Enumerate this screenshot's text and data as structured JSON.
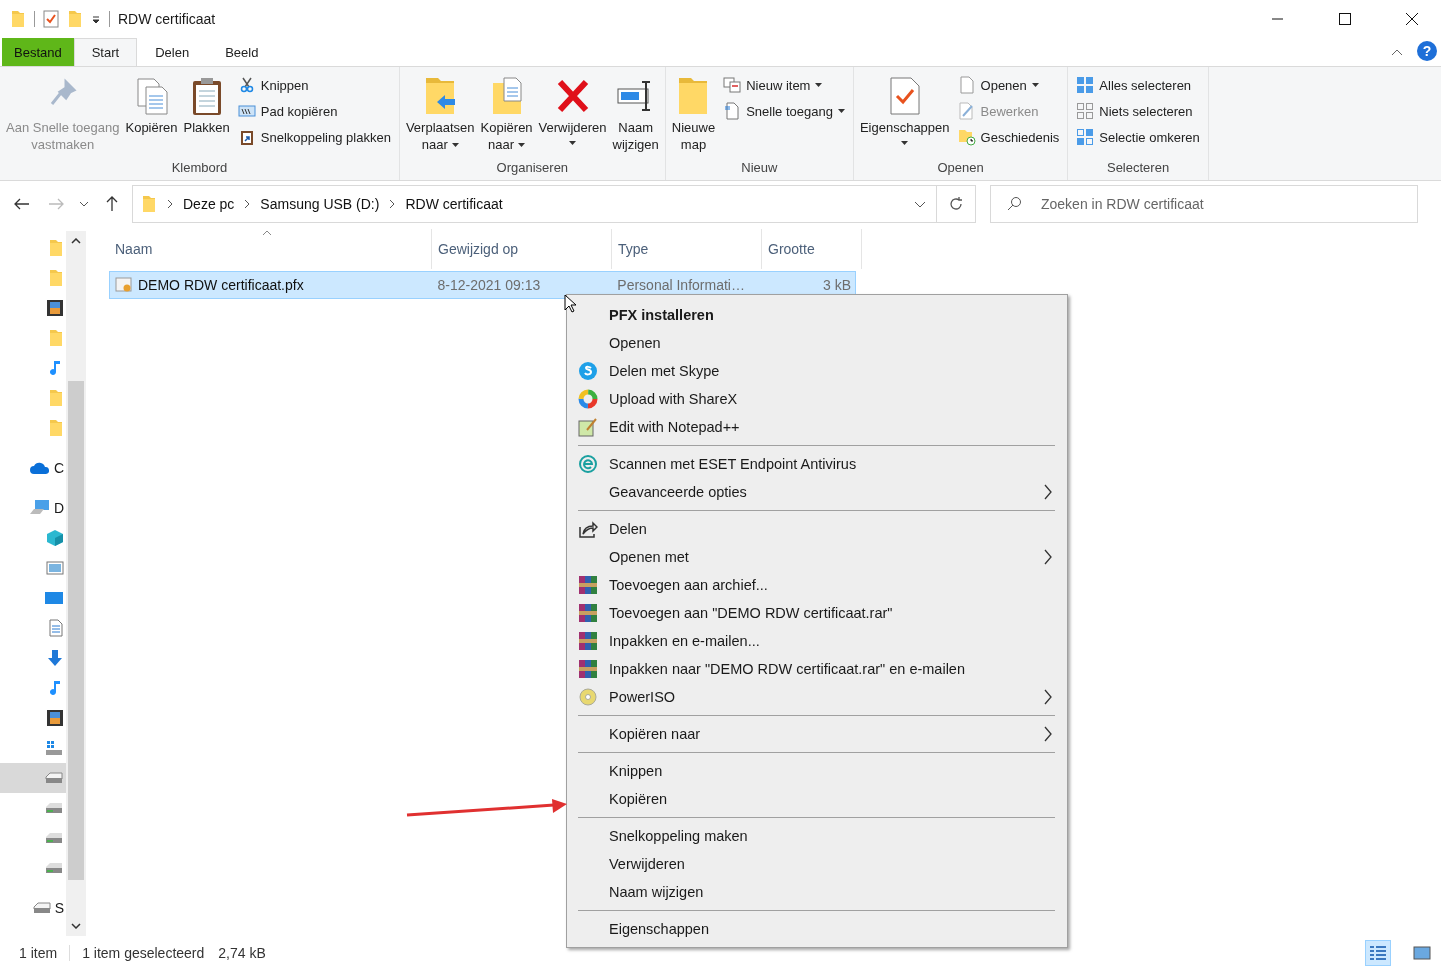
{
  "window": {
    "title": "RDW certificaat"
  },
  "ribbon_tabs": [
    {
      "label": "Bestand",
      "kind": "file",
      "selected": false
    },
    {
      "label": "Start",
      "kind": "tab",
      "selected": true
    },
    {
      "label": "Delen",
      "kind": "tab",
      "selected": false
    },
    {
      "label": "Beeld",
      "kind": "tab",
      "selected": false
    }
  ],
  "help": "?",
  "ribbon_groups": [
    {
      "name": "Klembord",
      "large": [
        {
          "lines": [
            "Aan Snelle toegang",
            "vastmaken"
          ],
          "disabled": true,
          "dropdown": false
        },
        {
          "lines": [
            "Kopiëren"
          ],
          "disabled": false,
          "dropdown": false
        },
        {
          "lines": [
            "Plakken"
          ],
          "disabled": false,
          "dropdown": false
        }
      ],
      "small": [
        {
          "label": "Knippen",
          "disabled": false,
          "dropdown": false
        },
        {
          "label": "Pad kopiëren",
          "disabled": false,
          "dropdown": false
        },
        {
          "label": "Snelkoppeling plakken",
          "disabled": false,
          "dropdown": false
        }
      ]
    },
    {
      "name": "Organiseren",
      "large": [
        {
          "lines": [
            "Verplaatsen",
            "naar"
          ],
          "disabled": false,
          "dropdown": true
        },
        {
          "lines": [
            "Kopiëren",
            "naar"
          ],
          "disabled": false,
          "dropdown": true
        },
        {
          "lines": [
            "Verwijderen"
          ],
          "disabled": false,
          "dropdown": true
        },
        {
          "lines": [
            "Naam",
            "wijzigen"
          ],
          "disabled": false,
          "dropdown": false
        }
      ]
    },
    {
      "name": "Nieuw",
      "large": [
        {
          "lines": [
            "Nieuwe",
            "map"
          ],
          "disabled": false,
          "dropdown": false
        }
      ],
      "small": [
        {
          "label": "Nieuw item",
          "disabled": false,
          "dropdown": true
        },
        {
          "label": "Snelle toegang",
          "disabled": false,
          "dropdown": true
        }
      ]
    },
    {
      "name": "Openen",
      "large": [
        {
          "lines": [
            "Eigenschappen"
          ],
          "disabled": false,
          "dropdown": true
        }
      ],
      "small": [
        {
          "label": "Openen",
          "disabled": false,
          "dropdown": true
        },
        {
          "label": "Bewerken",
          "disabled": true,
          "dropdown": false
        },
        {
          "label": "Geschiedenis",
          "disabled": false,
          "dropdown": false
        }
      ]
    },
    {
      "name": "Selecteren",
      "small": [
        {
          "label": "Alles selecteren",
          "disabled": false,
          "dropdown": false
        },
        {
          "label": "Niets selecteren",
          "disabled": false,
          "dropdown": false
        },
        {
          "label": "Selectie omkeren",
          "disabled": false,
          "dropdown": false
        }
      ]
    }
  ],
  "address": {
    "path": [
      "Deze pc",
      "Samsung USB (D:)",
      "RDW certificaat"
    ]
  },
  "search": {
    "placeholder": "Zoeken in RDW certificaat"
  },
  "sidebar": {
    "items": [
      {
        "selected": false
      },
      {
        "selected": false
      },
      {
        "selected": false
      },
      {
        "selected": false
      },
      {
        "selected": false
      },
      {
        "selected": false
      },
      {
        "selected": false
      },
      {
        "label": "C",
        "selected": false
      },
      {
        "label": "D",
        "selected": false
      },
      {
        "selected": false
      },
      {
        "selected": false
      },
      {
        "selected": false
      },
      {
        "selected": false
      },
      {
        "selected": false
      },
      {
        "selected": false
      },
      {
        "selected": false
      },
      {
        "selected": false
      },
      {
        "selected": true
      },
      {
        "selected": false
      },
      {
        "selected": false
      },
      {
        "selected": false
      },
      {
        "label": "S",
        "selected": false
      }
    ]
  },
  "table": {
    "columns": [
      "Naam",
      "Gewijzigd op",
      "Type",
      "Grootte"
    ],
    "rows": [
      {
        "cells": [
          "DEMO RDW certificaat.pfx",
          "8-12-2021 09:13",
          "Personal Informati…",
          "3 kB"
        ],
        "selected": true
      }
    ]
  },
  "context_menu": {
    "items": [
      {
        "kind": "item",
        "label": "PFX installeren",
        "bold": true,
        "submenu": false
      },
      {
        "kind": "item",
        "label": "Openen",
        "bold": false,
        "submenu": false
      },
      {
        "kind": "item",
        "label": "Delen met Skype",
        "bold": false,
        "submenu": false
      },
      {
        "kind": "item",
        "label": "Upload with ShareX",
        "bold": false,
        "submenu": false
      },
      {
        "kind": "item",
        "label": "Edit with Notepad++",
        "bold": false,
        "submenu": false
      },
      {
        "kind": "separator"
      },
      {
        "kind": "item",
        "label": "Scannen met ESET Endpoint Antivirus",
        "bold": false,
        "submenu": false
      },
      {
        "kind": "item",
        "label": "Geavanceerde opties",
        "bold": false,
        "submenu": true
      },
      {
        "kind": "separator"
      },
      {
        "kind": "item",
        "label": "Delen",
        "bold": false,
        "submenu": false
      },
      {
        "kind": "item",
        "label": "Openen met",
        "bold": false,
        "submenu": true
      },
      {
        "kind": "item",
        "label": "Toevoegen aan archief...",
        "bold": false,
        "submenu": false
      },
      {
        "kind": "item",
        "label": "Toevoegen aan \"DEMO RDW certificaat.rar\"",
        "bold": false,
        "submenu": false
      },
      {
        "kind": "item",
        "label": "Inpakken en e-mailen...",
        "bold": false,
        "submenu": false
      },
      {
        "kind": "item",
        "label": "Inpakken naar \"DEMO RDW certificaat.rar\" en e-mailen",
        "bold": false,
        "submenu": false
      },
      {
        "kind": "item",
        "label": "PowerISO",
        "bold": false,
        "submenu": true
      },
      {
        "kind": "separator"
      },
      {
        "kind": "item",
        "label": "Kopiëren naar",
        "bold": false,
        "submenu": true
      },
      {
        "kind": "separator"
      },
      {
        "kind": "item",
        "label": "Knippen",
        "bold": false,
        "submenu": false
      },
      {
        "kind": "item",
        "label": "Kopiëren",
        "bold": false,
        "submenu": false
      },
      {
        "kind": "separator"
      },
      {
        "kind": "item",
        "label": "Snelkoppeling maken",
        "bold": false,
        "submenu": false
      },
      {
        "kind": "item",
        "label": "Verwijderen",
        "bold": false,
        "submenu": false
      },
      {
        "kind": "item",
        "label": "Naam wijzigen",
        "bold": false,
        "submenu": false
      },
      {
        "kind": "separator"
      },
      {
        "kind": "item",
        "label": "Eigenschappen",
        "bold": false,
        "submenu": false
      }
    ]
  },
  "status_bar": {
    "count": "1 item",
    "selection": "1 item geselecteerd",
    "size": "2,74 kB"
  },
  "view_buttons": [
    {
      "kind": "details",
      "selected": true
    },
    {
      "kind": "large",
      "selected": false
    }
  ]
}
